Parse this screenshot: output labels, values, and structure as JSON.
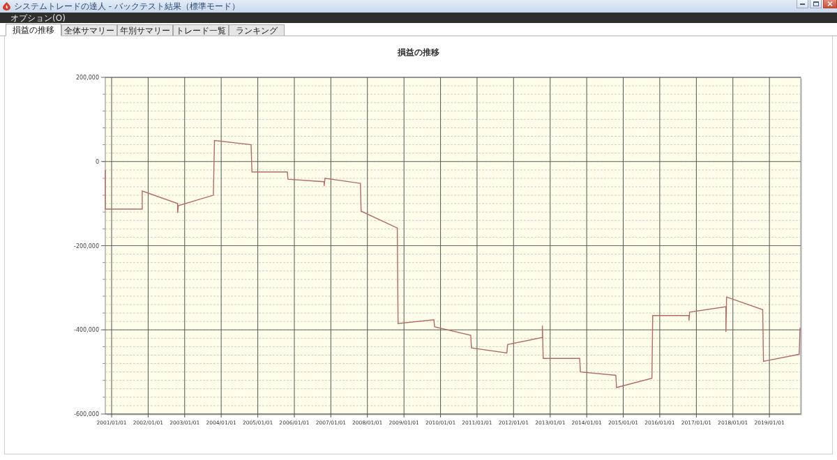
{
  "window": {
    "title": "システムトレードの達人 - バックテスト結果（標準モード）"
  },
  "menu": [
    "オプション(O)"
  ],
  "tabs": [
    {
      "label": "損益の推移",
      "selected": true
    },
    {
      "label": "全体サマリー",
      "selected": false
    },
    {
      "label": "年別サマリー",
      "selected": false
    },
    {
      "label": "トレード一覧",
      "selected": false
    },
    {
      "label": "ランキング",
      "selected": false
    }
  ],
  "chart": {
    "chart_data": {
      "type": "line",
      "title": "損益の推移",
      "grid": true,
      "x": [
        "2000-10-30",
        "2000-10-30",
        "2001-11-03",
        "2001-11-03",
        "2002-10-23",
        "2002-10-23",
        "2002-10-30",
        "2003-10-15",
        "2003-10-26",
        "2004-10-26",
        "2004-11-03",
        "2005-10-23",
        "2005-10-30",
        "2006-10-26",
        "2006-10-26",
        "2006-11-03",
        "2007-10-23",
        "2007-10-30",
        "2008-10-26",
        "2008-11-03",
        "2009-10-26",
        "2009-11-03",
        "2010-10-30",
        "2010-11-06",
        "2011-10-26",
        "2011-11-03",
        "2012-10-15",
        "2012-10-15",
        "2012-10-23",
        "2013-10-23",
        "2013-10-30",
        "2014-10-19",
        "2014-10-26",
        "2015-10-15",
        "2015-10-23",
        "2016-10-19",
        "2016-10-19",
        "2016-10-26",
        "2017-10-23",
        "2017-10-23",
        "2017-10-30",
        "2018-10-26",
        "2018-11-03",
        "2019-10-26",
        "2019-11-03"
      ],
      "series": [
        {
          "color": "#b26a6a",
          "values": [
            -20000,
            -113000,
            -113000,
            -70000,
            -100000,
            -122000,
            -105000,
            -80000,
            50000,
            40000,
            -25000,
            -25000,
            -42000,
            -48000,
            -58000,
            -40000,
            -52000,
            -118000,
            -158000,
            -385000,
            -376000,
            -393000,
            -413000,
            -443000,
            -455000,
            -435000,
            -418000,
            -390000,
            -468000,
            -468000,
            -500000,
            -508000,
            -537000,
            -515000,
            -366000,
            -366000,
            -378000,
            -358000,
            -345000,
            -405000,
            -322000,
            -352000,
            -475000,
            -458000,
            -395000
          ]
        }
      ],
      "xlim": [
        "2000-10-30",
        "2019-11-10"
      ],
      "ylim": [
        -600000,
        200000
      ],
      "xticks": [
        {
          "value": "2001-01-01",
          "label": "2001/01/01"
        },
        {
          "value": "2002-01-01",
          "label": "2002/01/01"
        },
        {
          "value": "2003-01-01",
          "label": "2003/01/01"
        },
        {
          "value": "2004-01-01",
          "label": "2004/01/01"
        },
        {
          "value": "2005-01-01",
          "label": "2005/01/01"
        },
        {
          "value": "2006-01-01",
          "label": "2006/01/01"
        },
        {
          "value": "2007-01-01",
          "label": "2007/01/01"
        },
        {
          "value": "2008-01-01",
          "label": "2008/01/01"
        },
        {
          "value": "2009-01-01",
          "label": "2009/01/01"
        },
        {
          "value": "2010-01-01",
          "label": "2010/01/01"
        },
        {
          "value": "2011-01-01",
          "label": "2011/01/01"
        },
        {
          "value": "2012-01-01",
          "label": "2012/01/01"
        },
        {
          "value": "2013-01-01",
          "label": "2013/01/01"
        },
        {
          "value": "2014-01-01",
          "label": "2014/01/01"
        },
        {
          "value": "2015-01-01",
          "label": "2015/01/01"
        },
        {
          "value": "2016-01-01",
          "label": "2016/01/01"
        },
        {
          "value": "2017-01-01",
          "label": "2017/01/01"
        },
        {
          "value": "2018-01-01",
          "label": "2018/01/01"
        },
        {
          "value": "2019-01-01",
          "label": "2019/01/01"
        }
      ],
      "yticks": [
        {
          "value": 200000,
          "label": "200,000"
        },
        {
          "value": 0,
          "label": "0"
        },
        {
          "value": -200000,
          "label": "-200,000"
        },
        {
          "value": -400000,
          "label": "-400,000"
        },
        {
          "value": -600000,
          "label": "-600,000"
        }
      ]
    }
  }
}
